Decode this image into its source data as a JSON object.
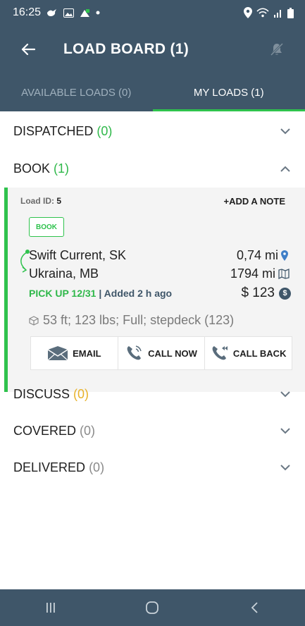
{
  "status_bar": {
    "time": "16:25"
  },
  "header": {
    "title": "LOAD BOARD (1)"
  },
  "tabs": [
    {
      "label": "AVAILABLE LOADS (0)",
      "active": false
    },
    {
      "label": "MY LOADS (1)",
      "active": true
    }
  ],
  "sections": {
    "dispatched": {
      "label": "DISPATCHED",
      "count": "(0)"
    },
    "book": {
      "label": "BOOK",
      "count": "(1)"
    },
    "discuss": {
      "label": "DISCUSS",
      "count": "(0)"
    },
    "covered": {
      "label": "COVERED",
      "count": "(0)"
    },
    "delivered": {
      "label": "DELIVERED",
      "count": "(0)"
    }
  },
  "load": {
    "id_label": "Load ID:",
    "id": "5",
    "add_note": "+ADD A NOTE",
    "status": "BOOK",
    "origin": "Swift Current, SK",
    "origin_distance": "0,74 mi",
    "destination": "Ukraina, MB",
    "destination_distance": "1794 mi",
    "pickup": "PICK UP 12/31",
    "separator": "|",
    "added": "Added 2 h ago",
    "price": "$ 123",
    "equipment": "53 ft; 123 lbs; Full; stepdeck (123)"
  },
  "actions": {
    "email": "EMAIL",
    "call_now": "CALL NOW",
    "call_back": "CALL BACK"
  },
  "colors": {
    "primary": "#3f5669",
    "accent_green": "#2fc24d",
    "discuss_yellow": "#e8b22a"
  }
}
